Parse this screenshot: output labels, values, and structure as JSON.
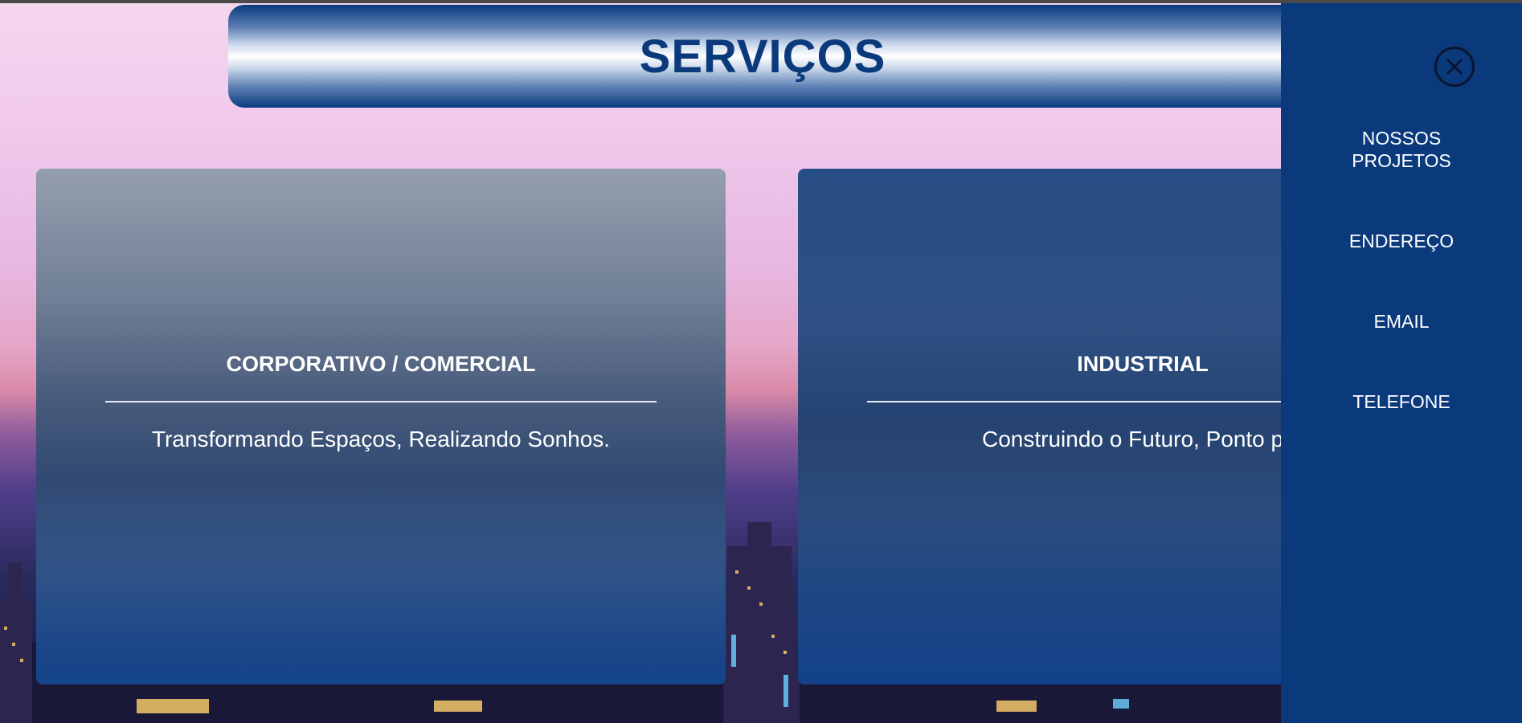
{
  "header": {
    "title": "SERVIÇOS"
  },
  "cards": [
    {
      "title": "CORPORATIVO / COMERCIAL",
      "description": "Transformando Espaços, Realizando Sonhos."
    },
    {
      "title": "INDUSTRIAL",
      "description": "Construindo o Futuro, Ponto por"
    }
  ],
  "sidebar": {
    "close_icon": "close-icon",
    "items": [
      {
        "label": "NOSSOS PROJETOS"
      },
      {
        "label": "ENDEREÇO"
      },
      {
        "label": "EMAIL"
      },
      {
        "label": "TELEFONE"
      }
    ]
  },
  "colors": {
    "brand_blue": "#0b3a7c",
    "text_white": "#ffffff"
  }
}
